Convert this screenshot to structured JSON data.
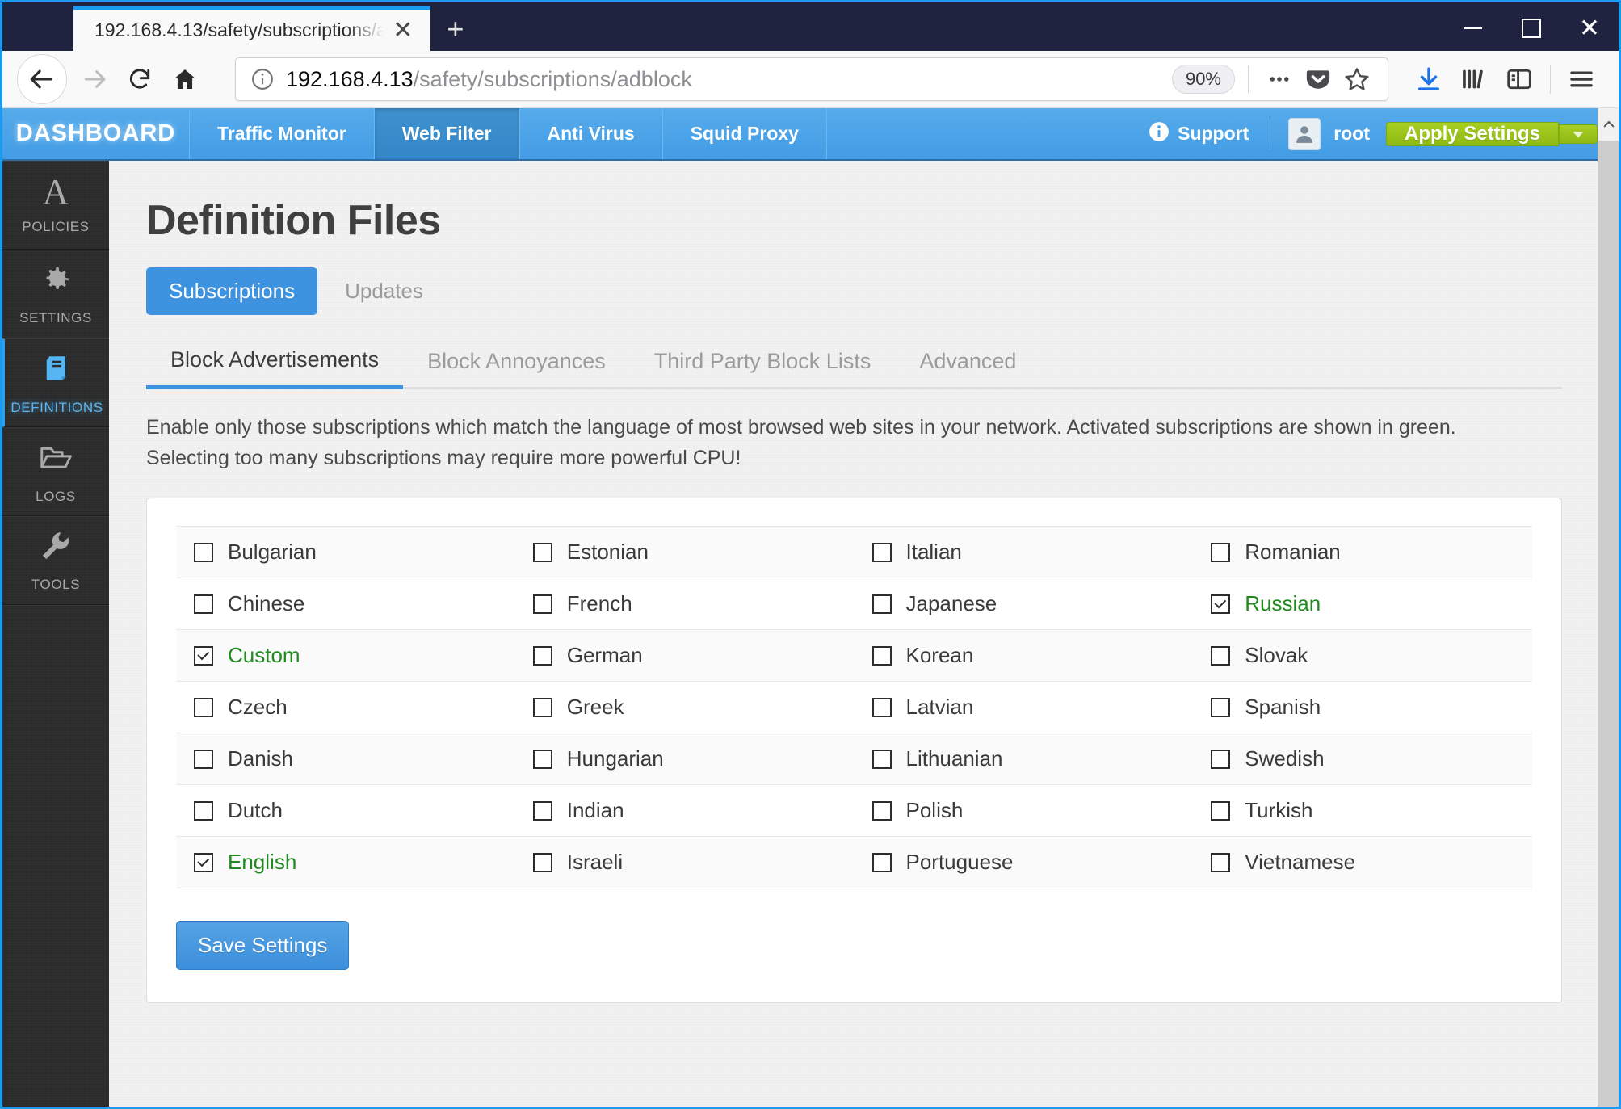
{
  "browser": {
    "tab_title": "192.168.4.13/safety/subscriptions/a",
    "tab_close_glyph": "✕",
    "newtab_glyph": "+",
    "url_host": "192.168.4.13",
    "url_path": "/safety/subscriptions/adblock",
    "zoom_level": "90%",
    "window_minimize": "—",
    "window_close": "✕"
  },
  "appnav": {
    "brand": "DASHBOARD",
    "items": [
      {
        "label": "Traffic Monitor",
        "active": false
      },
      {
        "label": "Web Filter",
        "active": true
      },
      {
        "label": "Anti Virus",
        "active": false
      },
      {
        "label": "Squid Proxy",
        "active": false
      }
    ],
    "support_label": "Support",
    "username": "root",
    "apply_label": "Apply Settings",
    "apply_caret": "▾"
  },
  "sidebar": {
    "items": [
      {
        "label": "POLICIES",
        "icon": "letter-a-icon",
        "active": false
      },
      {
        "label": "SETTINGS",
        "icon": "gear-icon",
        "active": false
      },
      {
        "label": "DEFINITIONS",
        "icon": "book-icon",
        "active": true
      },
      {
        "label": "LOGS",
        "icon": "folder-icon",
        "active": false
      },
      {
        "label": "TOOLS",
        "icon": "wrench-icon",
        "active": false
      }
    ]
  },
  "main": {
    "page_title": "Definition Files",
    "pills": [
      {
        "label": "Subscriptions",
        "active": true
      },
      {
        "label": "Updates",
        "active": false
      }
    ],
    "tabs": [
      {
        "label": "Block Advertisements",
        "active": true
      },
      {
        "label": "Block Annoyances",
        "active": false
      },
      {
        "label": "Third Party Block Lists",
        "active": false
      },
      {
        "label": "Advanced",
        "active": false
      }
    ],
    "description": "Enable only those subscriptions which match the language of most browsed web sites in your network. Activated subscriptions are shown in green. Selecting too many subscriptions may require more powerful CPU!",
    "save_label": "Save Settings",
    "rows": [
      [
        {
          "label": "Bulgarian",
          "checked": false
        },
        {
          "label": "Estonian",
          "checked": false
        },
        {
          "label": "Italian",
          "checked": false
        },
        {
          "label": "Romanian",
          "checked": false
        }
      ],
      [
        {
          "label": "Chinese",
          "checked": false
        },
        {
          "label": "French",
          "checked": false
        },
        {
          "label": "Japanese",
          "checked": false
        },
        {
          "label": "Russian",
          "checked": true
        }
      ],
      [
        {
          "label": "Custom",
          "checked": true
        },
        {
          "label": "German",
          "checked": false
        },
        {
          "label": "Korean",
          "checked": false
        },
        {
          "label": "Slovak",
          "checked": false
        }
      ],
      [
        {
          "label": "Czech",
          "checked": false
        },
        {
          "label": "Greek",
          "checked": false
        },
        {
          "label": "Latvian",
          "checked": false
        },
        {
          "label": "Spanish",
          "checked": false
        }
      ],
      [
        {
          "label": "Danish",
          "checked": false
        },
        {
          "label": "Hungarian",
          "checked": false
        },
        {
          "label": "Lithuanian",
          "checked": false
        },
        {
          "label": "Swedish",
          "checked": false
        }
      ],
      [
        {
          "label": "Dutch",
          "checked": false
        },
        {
          "label": "Indian",
          "checked": false
        },
        {
          "label": "Polish",
          "checked": false
        },
        {
          "label": "Turkish",
          "checked": false
        }
      ],
      [
        {
          "label": "English",
          "checked": true
        },
        {
          "label": "Israeli",
          "checked": false
        },
        {
          "label": "Portuguese",
          "checked": false
        },
        {
          "label": "Vietnamese",
          "checked": false
        }
      ]
    ]
  },
  "colors": {
    "accent_blue": "#3d93e0",
    "nav_blue": "#4ca5e8",
    "apply_green": "#9bc41c",
    "active_green": "#1f8a1f",
    "titlebar": "#20233f"
  }
}
